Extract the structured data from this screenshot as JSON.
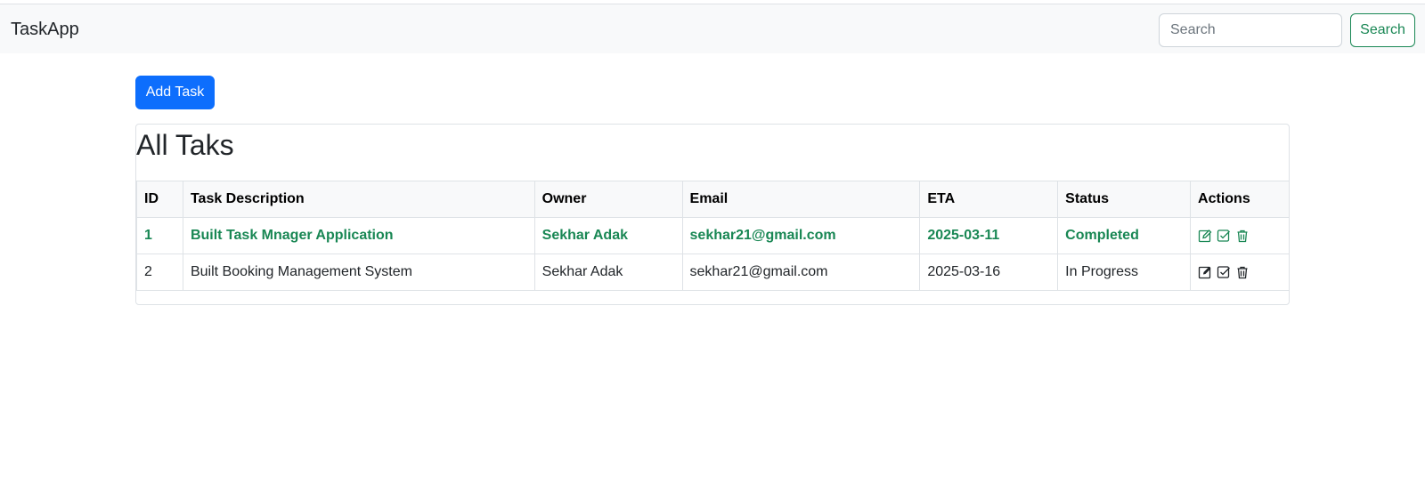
{
  "navbar": {
    "brand": "TaskApp",
    "search_placeholder": "Search",
    "search_button": "Search"
  },
  "toolbar": {
    "add_task_label": "Add Task"
  },
  "card": {
    "title": "All Taks"
  },
  "table": {
    "headers": [
      "ID",
      "Task Description",
      "Owner",
      "Email",
      "ETA",
      "Status",
      "Actions"
    ],
    "rows": [
      {
        "id": "1",
        "description": "Built Task Mnager Application",
        "owner": "Sekhar Adak",
        "email": "sekhar21@gmail.com",
        "eta": "2025-03-11",
        "status": "Completed"
      },
      {
        "id": "2",
        "description": "Built Booking Management System",
        "owner": "Sekhar Adak",
        "email": "sekhar21@gmail.com",
        "eta": "2025-03-16",
        "status": "In Progress"
      }
    ]
  },
  "icons": {
    "edit": "edit-icon",
    "complete": "check-square-icon",
    "delete": "trash-icon"
  },
  "colors": {
    "primary": "#0d6efd",
    "success": "#198754",
    "navbar_bg": "#f8f9fa"
  }
}
